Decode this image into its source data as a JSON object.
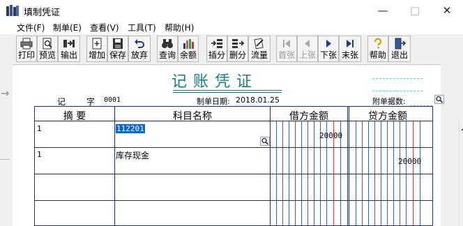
{
  "window": {
    "title": "填制凭证"
  },
  "menu": [
    "文件(F)",
    "制单(E)",
    "查看(V)",
    "工具(T)",
    "帮助(H)"
  ],
  "toolbar": [
    {
      "label": "打印",
      "icon": "printer-icon"
    },
    {
      "label": "预览",
      "icon": "preview-icon"
    },
    {
      "label": "输出",
      "icon": "export-icon"
    },
    {
      "label": "增加",
      "icon": "add-icon"
    },
    {
      "label": "保存",
      "icon": "save-icon"
    },
    {
      "label": "放弃",
      "icon": "undo-icon"
    },
    {
      "label": "查询",
      "icon": "binoculars-icon"
    },
    {
      "label": "余额",
      "icon": "balance-chart-icon"
    },
    {
      "label": "插分",
      "icon": "insert-row-icon"
    },
    {
      "label": "删分",
      "icon": "delete-row-icon"
    },
    {
      "label": "流量",
      "icon": "cashflow-icon"
    },
    {
      "label": "首张",
      "icon": "first-icon",
      "disabled": true
    },
    {
      "label": "上张",
      "icon": "prev-icon",
      "disabled": true
    },
    {
      "label": "下张",
      "icon": "next-icon"
    },
    {
      "label": "末张",
      "icon": "last-icon"
    },
    {
      "label": "帮助",
      "icon": "help-icon"
    },
    {
      "label": "退出",
      "icon": "exit-icon"
    }
  ],
  "voucher": {
    "title": "记账凭证",
    "type_label": "记",
    "zi_label": "字",
    "number": "0001",
    "date_label": "制单日期:",
    "date": "2018.01.25",
    "attachments_label": "附单据数:",
    "headers": {
      "summary": "摘 要",
      "account": "科目名称",
      "debit": "借方金额",
      "credit": "贷方金额"
    },
    "rows": [
      {
        "summary": "1",
        "account": "112201",
        "debit": "20000",
        "credit": ""
      },
      {
        "summary": "1",
        "account": "库存现金",
        "debit": "",
        "credit": "20000"
      }
    ]
  },
  "colors": {
    "title": "#157f80",
    "grid": "#1f2e7a",
    "red_line": "#d04040",
    "selection": "#0a66cc"
  }
}
